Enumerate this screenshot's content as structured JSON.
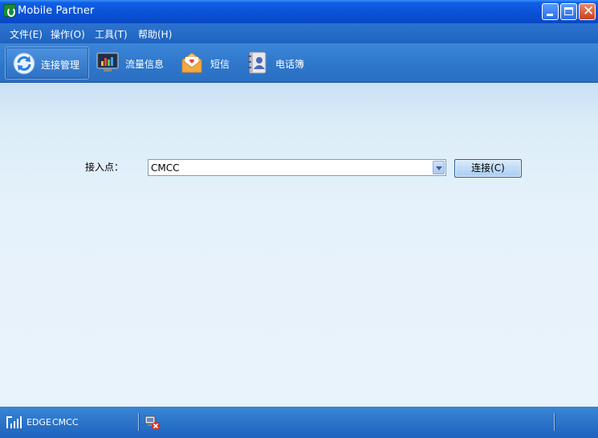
{
  "window": {
    "title": "Mobile Partner"
  },
  "menu": {
    "items": [
      {
        "label": "文件(E)"
      },
      {
        "label": "操作(O)"
      },
      {
        "label": "工具(T)"
      },
      {
        "label": "帮助(H)"
      }
    ]
  },
  "toolbar": {
    "items": [
      {
        "label": "连接管理",
        "icon": "refresh-icon",
        "active": true
      },
      {
        "label": "流量信息",
        "icon": "chart-monitor-icon",
        "active": false
      },
      {
        "label": "短信",
        "icon": "envelope-icon",
        "active": false
      },
      {
        "label": "电话簿",
        "icon": "contacts-book-icon",
        "active": false
      }
    ]
  },
  "connection": {
    "access_point_label": "接入点：",
    "access_point_value": "CMCC",
    "connect_button": "连接(C)"
  },
  "status": {
    "network_type": "EDGE",
    "operator": "CMCC"
  },
  "colors": {
    "titlebar": "#0a52d6",
    "toolbar": "#2f78cc",
    "content_bg": "#e6f2fb",
    "statusbar": "#2a73c8"
  }
}
